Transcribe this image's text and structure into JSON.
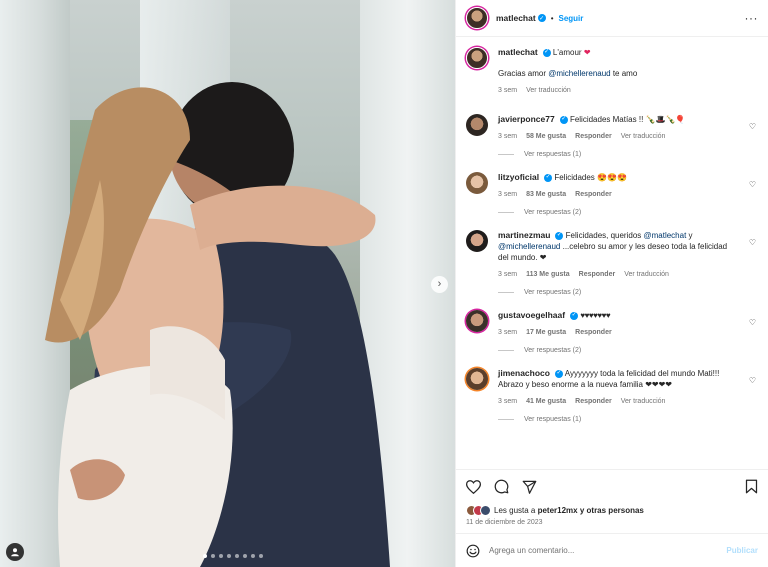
{
  "photo": {
    "carousel_total": 8,
    "carousel_active": 1,
    "next_icon": "chevron-right-icon",
    "tag_icon": "user-icon"
  },
  "header": {
    "username": "matlechat",
    "separator": "•",
    "follow_label": "Seguir",
    "more_icon": "···"
  },
  "caption": {
    "username": "matlechat",
    "line1": "L'amour",
    "line2_pre": "Gracias amor ",
    "line2_mention": "@michellerenaud",
    "line2_post": " te amo",
    "time": "3 sem",
    "translate": "Ver traducción"
  },
  "comments": [
    {
      "username": "javierponce77",
      "text": "Felicidades Matías !! 🍾🎩🍾🎈",
      "time": "3 sem",
      "likes": "58 Me gusta",
      "reply": "Responder",
      "translate": "Ver traducción",
      "view_replies": "Ver respuestas (1)"
    },
    {
      "username": "litzyoficial",
      "text": "Felicidades 😍😍😍",
      "time": "3 sem",
      "likes": "83 Me gusta",
      "reply": "Responder",
      "view_replies": "Ver respuestas (2)"
    },
    {
      "username": "martinezmau",
      "text_pre": "Felicidades, queridos ",
      "mention1": "@matlechat",
      "text_mid": " y ",
      "mention2": "@michellerenaud",
      "text_post": " ...celebro su amor y les deseo toda la felicidad del mundo. ❤",
      "time": "3 sem",
      "likes": "113 Me gusta",
      "reply": "Responder",
      "translate": "Ver traducción",
      "view_replies": "Ver respuestas (2)"
    },
    {
      "username": "gustavoegelhaaf",
      "text": "♥♥♥♥♥♥♥",
      "time": "3 sem",
      "likes": "17 Me gusta",
      "reply": "Responder",
      "view_replies": "Ver respuestas (2)"
    },
    {
      "username": "jimenachoco",
      "text": "Ayyyyyyy toda la felicidad del mundo Mati!!! Abrazo y beso enorme a la nueva familia ❤❤❤❤",
      "time": "3 sem",
      "likes": "41 Me gusta",
      "reply": "Responder",
      "translate": "Ver traducción",
      "view_replies": "Ver respuestas (1)"
    }
  ],
  "actions": {
    "like_icon": "heart-icon",
    "comment_icon": "comment-icon",
    "share_icon": "share-icon",
    "save_icon": "bookmark-icon"
  },
  "likes": {
    "prefix": "Les gusta a ",
    "user": "peter12mx",
    "suffix": " y otras personas"
  },
  "date": "11 de diciembre de 2023",
  "add_comment": {
    "placeholder": "Agrega un comentario...",
    "publish": "Publicar"
  },
  "colors": {
    "accent": "#0095f6",
    "heart_red": "#e0245e",
    "muted": "#737373"
  }
}
